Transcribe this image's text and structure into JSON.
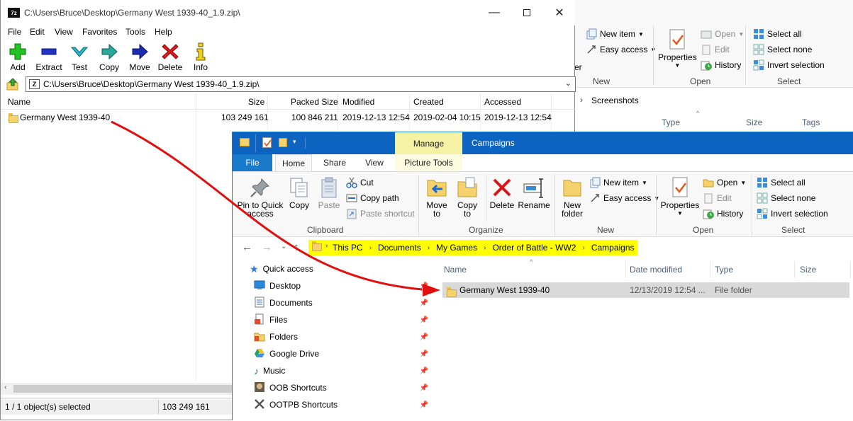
{
  "bg_explorer": {
    "new_item": "New item",
    "easy_access": "Easy access",
    "properties": "Properties",
    "open": "Open",
    "edit": "Edit",
    "history": "History",
    "select_all": "Select all",
    "select_none": "Select none",
    "invert_selection": "Invert selection",
    "group_new": "New",
    "group_open": "Open",
    "group_select": "Select",
    "partial_letter": "er",
    "breadcrumb_folder": "Screenshots",
    "columns": [
      "Type",
      "Size",
      "Tags"
    ]
  },
  "zip": {
    "title": "C:\\Users\\Bruce\\Desktop\\Germany West 1939-40_1.9.zip\\",
    "app_icon": "7z",
    "menu": [
      "File",
      "Edit",
      "View",
      "Favorites",
      "Tools",
      "Help"
    ],
    "toolbar": [
      {
        "label": "Add",
        "icon": "plus-icon"
      },
      {
        "label": "Extract",
        "icon": "minus-icon"
      },
      {
        "label": "Test",
        "icon": "check-arrow-icon"
      },
      {
        "label": "Copy",
        "icon": "copy-arrow-icon"
      },
      {
        "label": "Move",
        "icon": "move-arrow-icon"
      },
      {
        "label": "Delete",
        "icon": "x-icon"
      },
      {
        "label": "Info",
        "icon": "info-icon"
      }
    ],
    "address": "C:\\Users\\Bruce\\Desktop\\Germany West 1939-40_1.9.zip\\",
    "columns": [
      "Name",
      "Size",
      "Packed Size",
      "Modified",
      "Created",
      "Accessed"
    ],
    "rows": [
      {
        "name": "Germany West 1939-40",
        "size": "103 249 161",
        "packed": "100 846 211",
        "modified": "2019-12-13 12:54",
        "created": "2019-02-04 10:15",
        "accessed": "2019-12-13 12:54"
      }
    ],
    "status_selected": "1 / 1 object(s) selected",
    "status_size": "103 249 161"
  },
  "explorer": {
    "manage": "Manage",
    "title": "Campaigns",
    "tabs": [
      "File",
      "Home",
      "Share",
      "View",
      "Picture Tools"
    ],
    "clipboard": {
      "pin": "Pin to Quick access",
      "copy": "Copy",
      "paste": "Paste",
      "cut": "Cut",
      "copy_path": "Copy path",
      "paste_shortcut": "Paste shortcut",
      "label": "Clipboard"
    },
    "organize": {
      "move_to": "Move to",
      "copy_to": "Copy to",
      "delete": "Delete",
      "rename": "Rename",
      "label": "Organize"
    },
    "new": {
      "new_folder": "New folder",
      "new_item": "New item",
      "easy_access": "Easy access",
      "label": "New"
    },
    "open": {
      "properties": "Properties",
      "open": "Open",
      "edit": "Edit",
      "history": "History",
      "label": "Open"
    },
    "select": {
      "select_all": "Select all",
      "select_none": "Select none",
      "invert_selection": "Invert selection",
      "label": "Select"
    },
    "breadcrumb": [
      "This PC",
      "Documents",
      "My Games",
      "Order of Battle - WW2",
      "Campaigns"
    ],
    "nav": [
      {
        "label": "Quick access",
        "icon": "star-icon"
      },
      {
        "label": "Desktop",
        "icon": "desktop-icon"
      },
      {
        "label": "Documents",
        "icon": "documents-icon"
      },
      {
        "label": "Files",
        "icon": "files-icon"
      },
      {
        "label": "Folders",
        "icon": "folders-icon"
      },
      {
        "label": "Google Drive",
        "icon": "google-drive-icon"
      },
      {
        "label": "Music",
        "icon": "music-icon"
      },
      {
        "label": "OOB Shortcuts",
        "icon": "oob-icon"
      },
      {
        "label": "OOTPB Shortcuts",
        "icon": "ootpb-icon"
      }
    ],
    "columns": [
      "Name",
      "Date modified",
      "Type",
      "Size"
    ],
    "rows": [
      {
        "name": "Germany West 1939-40",
        "date": "12/13/2019 12:54 ...",
        "type": "File folder"
      }
    ]
  },
  "colors": {
    "explorer_titlebar": "#0c64c0",
    "manage_tab": "#f6f2a4",
    "breadcrumb_highlight": "#ffff00",
    "arrow": "#e01010",
    "selection_row": "#d9d9d9"
  }
}
